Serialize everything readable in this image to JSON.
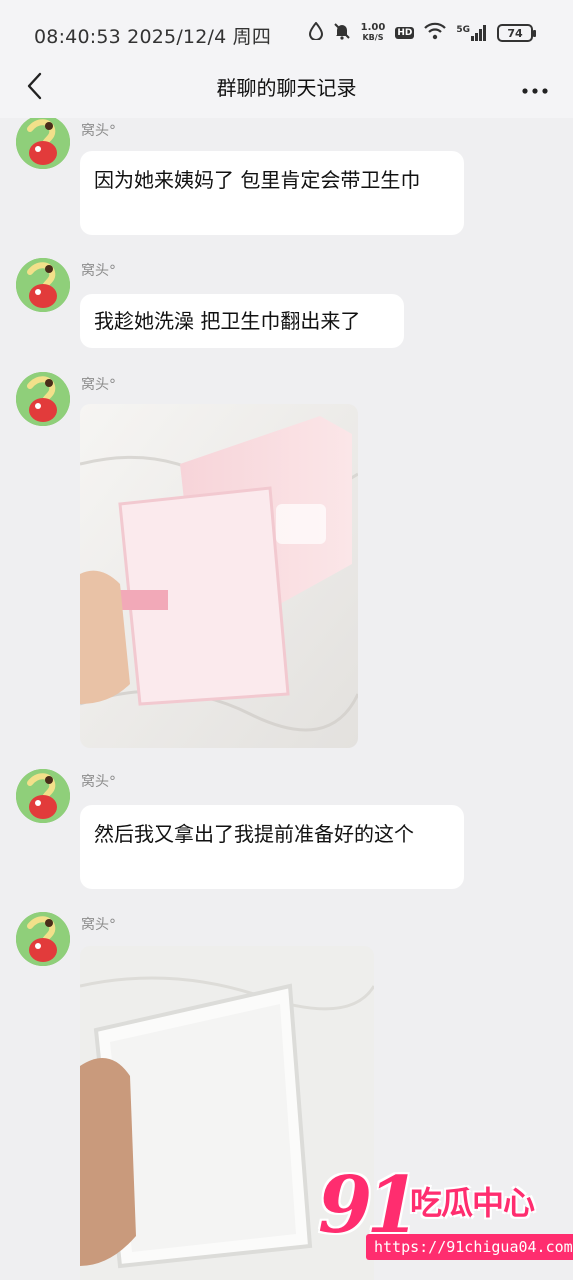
{
  "status_bar": {
    "time": "08:40:53 2025/12/4 周四",
    "net_speed_value": "1.00",
    "net_speed_unit": "KB/S",
    "hd_label": "HD",
    "signal_label": "5G",
    "battery": "74"
  },
  "nav": {
    "title": "群聊的聊天记录",
    "back_icon": "chevron-left-icon",
    "more_icon": "more-horizontal-icon"
  },
  "messages": [
    {
      "sender": "窝头°",
      "type": "text",
      "text": "因为她来姨妈了 包里肯定会带卫生巾"
    },
    {
      "sender": "窝头°",
      "type": "text",
      "text": "我趁她洗澡 把卫生巾翻出来了"
    },
    {
      "sender": "窝头°",
      "type": "image",
      "alt": "pink sanitary pad package photo"
    },
    {
      "sender": "窝头°",
      "type": "text",
      "text": "然后我又拿出了我提前准备好的这个"
    },
    {
      "sender": "窝头°",
      "type": "image",
      "alt": "white pad photo"
    }
  ],
  "watermark": {
    "number": "91",
    "name": "吃瓜中心",
    "url": "https://91chigua04.com"
  },
  "colors": {
    "background": "#efeff1",
    "bubble": "#ffffff",
    "sender_name": "#8c8c8c",
    "watermark": "#ff2d6f"
  }
}
